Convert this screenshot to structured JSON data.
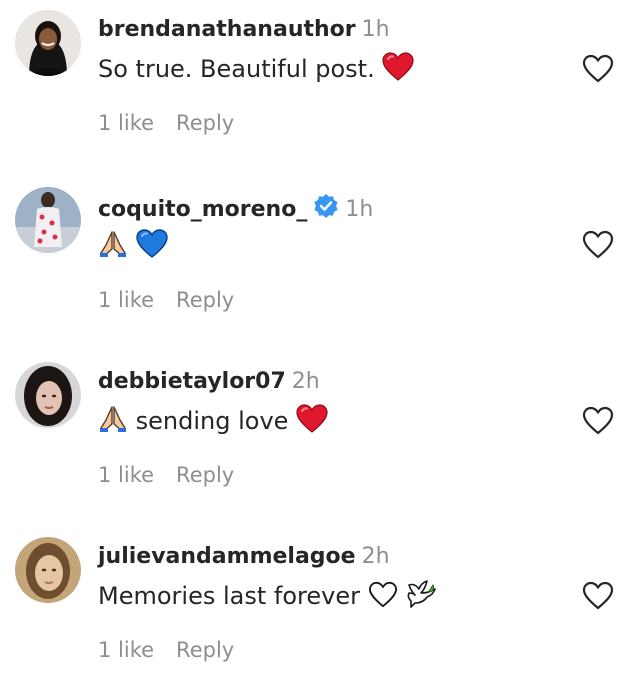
{
  "comments": [
    {
      "username": "brendanathanauthor",
      "verified": false,
      "timestamp": "1h",
      "text": "So true. Beautiful post.",
      "likes": "1 like",
      "reply": "Reply"
    },
    {
      "username": "coquito_moreno_",
      "verified": true,
      "timestamp": "1h",
      "text": "",
      "likes": "1 like",
      "reply": "Reply"
    },
    {
      "username": "debbietaylor07",
      "verified": false,
      "timestamp": "2h",
      "text": "sending love",
      "likes": "1 like",
      "reply": "Reply"
    },
    {
      "username": "julievandammelagoe",
      "verified": false,
      "timestamp": "2h",
      "text": "Memories last forever",
      "likes": "1 like",
      "reply": "Reply"
    }
  ],
  "colors": {
    "verified_blue": "#3897f0",
    "heart_red": "#e0182d",
    "heart_blue": "#1f7ae0",
    "secondary_text": "#8e8e8e"
  }
}
